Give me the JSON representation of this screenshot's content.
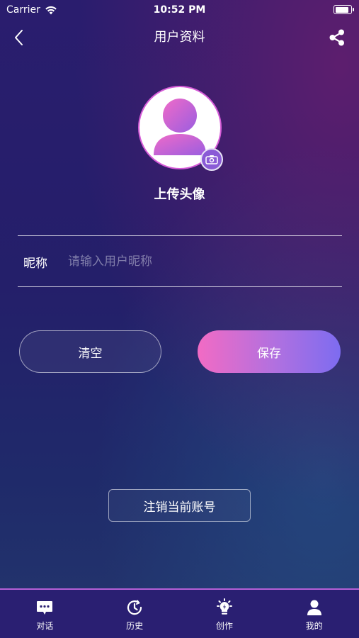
{
  "status_bar": {
    "carrier": "Carrier",
    "time": "10:52 PM",
    "battery_level": 1.0
  },
  "nav": {
    "title": "用户资料",
    "back_icon": "chevron-left-icon",
    "share_icon": "share-icon"
  },
  "avatar": {
    "upload_label": "上传头像",
    "camera_icon": "camera-icon"
  },
  "form": {
    "nickname_label": "昵称",
    "nickname_placeholder": "请输入用户昵称",
    "nickname_value": ""
  },
  "actions": {
    "clear_label": "清空",
    "save_label": "保存",
    "logout_label": "注销当前账号"
  },
  "tabs": [
    {
      "label": "对话",
      "icon": "chat-icon"
    },
    {
      "label": "历史",
      "icon": "history-icon"
    },
    {
      "label": "创作",
      "icon": "bulb-icon"
    },
    {
      "label": "我的",
      "icon": "profile-icon"
    }
  ],
  "colors": {
    "accent_pink": "#f26bc4",
    "accent_purple": "#7d6cf0",
    "tab_bar_bg": "#2a1f72"
  }
}
